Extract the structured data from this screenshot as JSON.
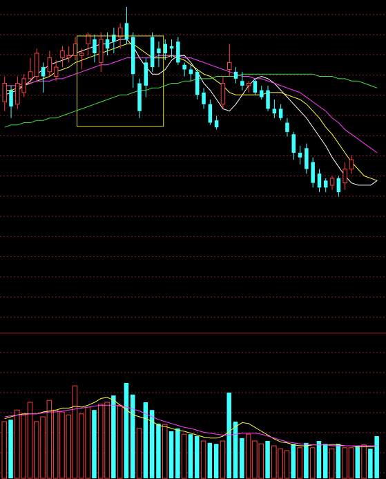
{
  "colors": {
    "background": "#000000",
    "up": "#ff4040",
    "down": "#40ffff",
    "grid": "#8b2323",
    "divider": "#a0142a",
    "ma5": "#ffffff",
    "ma10": "#ffff40",
    "ma20": "#ff40ff",
    "ma60": "#40e040",
    "highlight": "#e0e040"
  },
  "chart_data": [
    {
      "type": "candlestick",
      "title": "",
      "price_range": [
        0,
        100
      ],
      "highlight_range": {
        "from_index": 12,
        "to_index": 24
      },
      "candles": [
        {
          "open": 59,
          "close": 67,
          "high": 70,
          "low": 55
        },
        {
          "open": 64,
          "close": 57,
          "high": 66,
          "low": 52
        },
        {
          "open": 58,
          "close": 67,
          "high": 70,
          "low": 56
        },
        {
          "open": 63,
          "close": 69,
          "high": 71,
          "low": 61
        },
        {
          "open": 69,
          "close": 72,
          "high": 78,
          "low": 67
        },
        {
          "open": 70,
          "close": 80,
          "high": 82,
          "low": 68
        },
        {
          "open": 74,
          "close": 70,
          "high": 76,
          "low": 63
        },
        {
          "open": 72,
          "close": 78,
          "high": 81,
          "low": 70
        },
        {
          "open": 70,
          "close": 74,
          "high": 77,
          "low": 68
        },
        {
          "open": 78,
          "close": 81,
          "high": 83,
          "low": 74
        },
        {
          "open": 78,
          "close": 79,
          "high": 83,
          "low": 76
        },
        {
          "open": 79,
          "close": 84,
          "high": 87,
          "low": 77
        },
        {
          "open": 79,
          "close": 80,
          "high": 82,
          "low": 73
        },
        {
          "open": 84,
          "close": 88,
          "high": 89,
          "low": 79
        },
        {
          "open": 86,
          "close": 80,
          "high": 88,
          "low": 76
        },
        {
          "open": 76,
          "close": 86,
          "high": 89,
          "low": 72
        },
        {
          "open": 86,
          "close": 82,
          "high": 89,
          "low": 79
        },
        {
          "open": 88,
          "close": 85,
          "high": 91,
          "low": 80
        },
        {
          "open": 87,
          "close": 91,
          "high": 93,
          "low": 82
        },
        {
          "open": 93,
          "close": 86,
          "high": 100,
          "low": 84
        },
        {
          "open": 87,
          "close": 71,
          "high": 89,
          "low": 65
        },
        {
          "open": 67,
          "close": 55,
          "high": 69,
          "low": 52
        },
        {
          "open": 76,
          "close": 66,
          "high": 78,
          "low": 61
        },
        {
          "open": 87,
          "close": 74,
          "high": 89,
          "low": 72
        },
        {
          "open": 82,
          "close": 80,
          "high": 85,
          "low": 74
        }
      ],
      "candles_after_box": [
        {
          "open": 84,
          "close": 80,
          "high": 86,
          "low": 77
        },
        {
          "open": 83,
          "close": 82,
          "high": 86,
          "low": 78
        },
        {
          "open": 85,
          "close": 76,
          "high": 87,
          "low": 75
        },
        {
          "open": 75,
          "close": 73,
          "high": 76,
          "low": 70
        },
        {
          "open": 73,
          "close": 71,
          "high": 75,
          "low": 68
        },
        {
          "open": 72,
          "close": 62,
          "high": 73,
          "low": 60
        },
        {
          "open": 63,
          "close": 58,
          "high": 65,
          "low": 56
        },
        {
          "open": 58,
          "close": 50,
          "high": 60,
          "low": 49
        },
        {
          "open": 51,
          "close": 48,
          "high": 53,
          "low": 47
        },
        {
          "open": 58,
          "close": 67,
          "high": 70,
          "low": 56
        },
        {
          "open": 73,
          "close": 76,
          "high": 84,
          "low": 70
        },
        {
          "open": 72,
          "close": 69,
          "high": 74,
          "low": 67
        },
        {
          "open": 68,
          "close": 66,
          "high": 72,
          "low": 64
        },
        {
          "open": 66,
          "close": 67,
          "high": 68,
          "low": 63
        },
        {
          "open": 68,
          "close": 63,
          "high": 69,
          "low": 62
        },
        {
          "open": 64,
          "close": 61,
          "high": 66,
          "low": 60
        },
        {
          "open": 64,
          "close": 56,
          "high": 66,
          "low": 55
        },
        {
          "open": 56,
          "close": 54,
          "high": 60,
          "low": 52
        },
        {
          "open": 56,
          "close": 52,
          "high": 58,
          "low": 51
        },
        {
          "open": 50,
          "close": 46,
          "high": 52,
          "low": 44
        },
        {
          "open": 45,
          "close": 37,
          "high": 46,
          "low": 34
        },
        {
          "open": 37,
          "close": 35,
          "high": 40,
          "low": 32
        },
        {
          "open": 39,
          "close": 30,
          "high": 41,
          "low": 28
        },
        {
          "open": 33,
          "close": 24,
          "high": 35,
          "low": 22
        },
        {
          "open": 28,
          "close": 22,
          "high": 30,
          "low": 20
        },
        {
          "open": 25,
          "close": 22,
          "high": 26,
          "low": 20
        },
        {
          "open": 23,
          "close": 26,
          "high": 27,
          "low": 21
        },
        {
          "open": 26,
          "close": 20,
          "high": 27,
          "low": 18
        },
        {
          "open": 24,
          "close": 30,
          "high": 33,
          "low": 21
        },
        {
          "open": 30,
          "close": 34,
          "high": 36,
          "low": 28
        }
      ],
      "ma_lines": {
        "ma5": [
          62,
          63,
          64,
          66,
          68,
          71,
          73,
          75,
          76,
          77,
          78,
          80,
          81,
          82,
          83,
          84,
          84,
          85,
          86,
          86,
          83,
          78,
          74,
          71,
          71,
          73,
          77,
          79,
          79,
          76,
          72,
          67,
          64,
          60,
          56,
          55,
          58,
          62,
          66,
          69,
          70,
          69,
          67,
          64,
          61,
          58,
          55,
          52,
          48,
          44,
          40,
          35,
          31,
          27,
          24,
          23,
          23,
          23,
          25
        ],
        "ma10": [
          64,
          64,
          65,
          66,
          67,
          68,
          69,
          70,
          72,
          73,
          74,
          76,
          77,
          78,
          79,
          80,
          81,
          82,
          83,
          84,
          84,
          82,
          80,
          78,
          78,
          78,
          79,
          78,
          77,
          75,
          73,
          71,
          70,
          68,
          66,
          63,
          62,
          62,
          62,
          62,
          62,
          63,
          63,
          63,
          62,
          61,
          60,
          58,
          55,
          52,
          48,
          45,
          41,
          37,
          33,
          30,
          27,
          26,
          25
        ],
        "ma20": [
          66,
          66,
          66,
          67,
          67,
          68,
          68,
          68,
          69,
          69,
          70,
          71,
          72,
          73,
          74,
          75,
          75,
          76,
          77,
          78,
          78,
          78,
          78,
          78,
          79,
          79,
          79,
          79,
          78,
          78,
          77,
          76,
          75,
          74,
          73,
          72,
          71,
          70,
          70,
          69,
          69,
          68,
          67,
          66,
          65,
          64,
          63,
          61,
          59,
          57,
          55,
          52,
          50,
          47,
          45,
          43,
          41,
          39,
          37
        ],
        "ma60": [
          48,
          49,
          49,
          50,
          50,
          51,
          51,
          52,
          52,
          53,
          54,
          55,
          56,
          57,
          58,
          59,
          60,
          61,
          62,
          62,
          63,
          64,
          64,
          65,
          65,
          66,
          67,
          67,
          68,
          68,
          69,
          69,
          69,
          70,
          70,
          70,
          70,
          71,
          71,
          71,
          71,
          71,
          71,
          71,
          71,
          71,
          71,
          71,
          71,
          70,
          70,
          70,
          69,
          69,
          68,
          68,
          67,
          66,
          65
        ]
      }
    },
    {
      "type": "bar",
      "title": "",
      "volume_range": [
        0,
        100
      ],
      "volumes": [
        {
          "value": 50,
          "up": true
        },
        {
          "value": 52,
          "up": false
        },
        {
          "value": 62,
          "up": true
        },
        {
          "value": 58,
          "up": true
        },
        {
          "value": 70,
          "up": true
        },
        {
          "value": 50,
          "up": true
        },
        {
          "value": 55,
          "up": true
        },
        {
          "value": 72,
          "up": true
        },
        {
          "value": 62,
          "up": true
        },
        {
          "value": 60,
          "up": true
        },
        {
          "value": 57,
          "up": true
        },
        {
          "value": 87,
          "up": true
        },
        {
          "value": 58,
          "up": true
        },
        {
          "value": 65,
          "up": true
        },
        {
          "value": 62,
          "up": false
        },
        {
          "value": 68,
          "up": true
        },
        {
          "value": 70,
          "up": true
        },
        {
          "value": 77,
          "up": false
        },
        {
          "value": 67,
          "up": true
        },
        {
          "value": 90,
          "up": false
        },
        {
          "value": 78,
          "up": false
        },
        {
          "value": 43,
          "up": true
        },
        {
          "value": 70,
          "up": false
        },
        {
          "value": 62,
          "up": false
        },
        {
          "value": 48,
          "up": false
        },
        {
          "value": 47,
          "up": true
        },
        {
          "value": 40,
          "up": false
        },
        {
          "value": 43,
          "up": false
        },
        {
          "value": 37,
          "up": true
        },
        {
          "value": 37,
          "up": false
        },
        {
          "value": 35,
          "up": false
        },
        {
          "value": 30,
          "up": true
        },
        {
          "value": 28,
          "up": false
        },
        {
          "value": 27,
          "up": false
        },
        {
          "value": 30,
          "up": true
        },
        {
          "value": 80,
          "up": false
        },
        {
          "value": 50,
          "up": false
        },
        {
          "value": 33,
          "up": false
        },
        {
          "value": 37,
          "up": true
        },
        {
          "value": 30,
          "up": true
        },
        {
          "value": 27,
          "up": true
        },
        {
          "value": 30,
          "up": false
        },
        {
          "value": 25,
          "up": true
        },
        {
          "value": 22,
          "up": true
        },
        {
          "value": 20,
          "up": true
        },
        {
          "value": 27,
          "up": false
        },
        {
          "value": 23,
          "up": true
        },
        {
          "value": 28,
          "up": false
        },
        {
          "value": 23,
          "up": true
        },
        {
          "value": 30,
          "up": false
        },
        {
          "value": 27,
          "up": false
        },
        {
          "value": 22,
          "up": true
        },
        {
          "value": 27,
          "up": false
        },
        {
          "value": 23,
          "up": true
        },
        {
          "value": 23,
          "up": true
        },
        {
          "value": 25,
          "up": false
        },
        {
          "value": 26,
          "up": true
        },
        {
          "value": 22,
          "up": false
        },
        {
          "value": 35,
          "up": false
        }
      ],
      "ma_lines": {
        "vol_ma5": [
          53,
          55,
          57,
          58,
          58,
          58,
          60,
          61,
          62,
          64,
          64,
          66,
          65,
          67,
          70,
          74,
          75,
          72,
          67,
          62,
          57,
          55,
          53,
          50,
          46,
          45,
          43,
          41,
          40,
          38,
          36,
          34,
          33,
          33,
          35,
          40,
          45,
          49,
          48,
          44,
          40,
          36,
          32,
          29,
          28,
          26,
          25,
          25,
          26,
          26,
          26,
          26,
          26,
          25,
          25,
          24,
          24,
          24,
          25
        ],
        "vol_ma10": [
          55,
          56,
          57,
          57,
          58,
          58,
          59,
          60,
          60,
          61,
          62,
          63,
          64,
          65,
          66,
          67,
          67,
          67,
          66,
          65,
          63,
          61,
          58,
          55,
          52,
          50,
          48,
          46,
          44,
          43,
          41,
          39,
          38,
          37,
          36,
          36,
          37,
          38,
          38,
          38,
          37,
          35,
          33,
          31,
          29,
          28,
          27,
          27,
          26,
          26,
          26,
          25,
          25,
          25,
          25,
          25,
          25,
          25,
          25
        ]
      }
    }
  ]
}
